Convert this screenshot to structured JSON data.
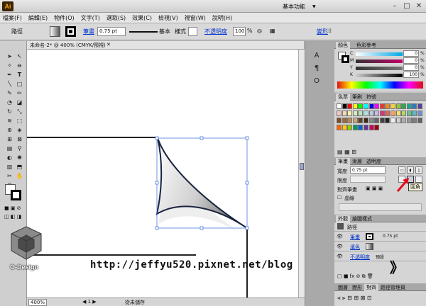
{
  "titlebar": {
    "app_icon": "Ai",
    "workspace": "基本功能",
    "minimize": "–",
    "maximize": "□",
    "close": "✕"
  },
  "menubar": [
    "檔案(F)",
    "編輯(E)",
    "物件(O)",
    "文字(T)",
    "選取(S)",
    "效果(C)",
    "檢視(V)",
    "視窗(W)",
    "說明(H)"
  ],
  "control": {
    "object_type": "路徑",
    "stroke_label": "筆畫",
    "stroke_weight": "0.75 pt",
    "brush_label": "基本",
    "style_label": "樣式",
    "opacity_label": "不透明度",
    "opacity_value": "100",
    "opacity_unit": "%",
    "transform_label": "變形"
  },
  "document": {
    "tab_title": "未命名-2* @ 400% (CMYK/預視)",
    "zoom": "400%",
    "status": "從未儲存"
  },
  "color_panel": {
    "tabs": [
      "顏色",
      "色彩參考"
    ],
    "channels": [
      {
        "label": "C",
        "value": "0"
      },
      {
        "label": "M",
        "value": "0"
      },
      {
        "label": "Y",
        "value": "0"
      },
      {
        "label": "K",
        "value": "100"
      }
    ],
    "unit": "%"
  },
  "swatches_panel": {
    "tabs": [
      "色票",
      "筆刷",
      "符號"
    ],
    "colors": [
      "#ffffff",
      "#000000",
      "#ff0000",
      "#ffff00",
      "#00ff00",
      "#00ffff",
      "#0000ff",
      "#ff00ff",
      "#e63a2e",
      "#f08a24",
      "#f6d12b",
      "#8dc63f",
      "#2fa84f",
      "#1ca59a",
      "#2a7bbf",
      "#5b3d99",
      "#f3c6c6",
      "#f6d9b0",
      "#fbf1b6",
      "#d8ebb8",
      "#b7e1c1",
      "#b5e2e0",
      "#b3cde9",
      "#c8bde0",
      "#d6367a",
      "#e95f5f",
      "#f7a35c",
      "#fde06a",
      "#b3d66b",
      "#6cc08b",
      "#5fb7c9",
      "#6f8fd0",
      "#7a4a2a",
      "#9b6a3a",
      "#b58a55",
      "#c8a878",
      "#5c4028",
      "#3e2a1a",
      "#888888",
      "#666666",
      "#444444",
      "#222222",
      "#f0f0f0",
      "#d0d0d0",
      "#b0b0b0",
      "#999999",
      "#7f7f7f",
      "#606060",
      "#ff6600",
      "#ffcc00",
      "#99cc00",
      "#009966",
      "#0066cc",
      "#663399",
      "#cc0066",
      "#990000"
    ]
  },
  "stroke_panel": {
    "tabs": [
      "筆畫",
      "漸層",
      "透明度"
    ],
    "weight_label": "寬度",
    "weight_value": "0.75 pt",
    "limit_label": "限度",
    "align_label": "對齊筆畫",
    "dashed_label": "虛線",
    "tooltip": "圓角"
  },
  "appearance_panel": {
    "tabs": [
      "外觀",
      "繪圖樣式"
    ],
    "object": "路徑",
    "stroke_label": "筆畫",
    "stroke_value": "0.75 pt",
    "fill_label": "填色",
    "opacity_label": "不透明度",
    "opacity_value": "預設"
  },
  "layers_panel": {
    "tabs": [
      "圖層",
      "變形",
      "對齊",
      "路徑管理員"
    ]
  },
  "watermark": {
    "url": "http://jeffyu520.pixnet.net/blog",
    "brand": "O-Design",
    "chevrons": "》"
  },
  "colors": {
    "accent_arrow": "#e0101a",
    "link": "#0033cc",
    "selection": "#4a7bdc"
  }
}
